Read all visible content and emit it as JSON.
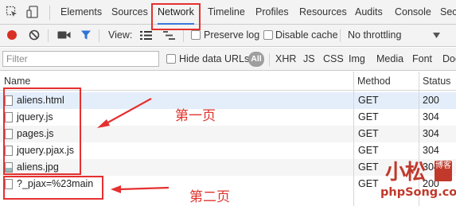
{
  "tabs": {
    "items": [
      "Elements",
      "Sources",
      "Network",
      "Timeline",
      "Profiles",
      "Resources",
      "Audits",
      "Console",
      "Sec"
    ],
    "active": "Network"
  },
  "toolbar": {
    "view_label": "View:",
    "preserve_log": "Preserve log",
    "disable_cache": "Disable cache",
    "throttling": "No throttling"
  },
  "filter": {
    "placeholder": "Filter",
    "hide_data_urls": "Hide data URLs",
    "all": "All",
    "types": [
      "XHR",
      "JS",
      "CSS",
      "Img",
      "Media",
      "Font",
      "Doc"
    ]
  },
  "table": {
    "headers": {
      "name": "Name",
      "method": "Method",
      "status": "Status"
    },
    "rows": [
      {
        "name": "aliens.html",
        "method": "GET",
        "status": "200"
      },
      {
        "name": "jquery.js",
        "method": "GET",
        "status": "304"
      },
      {
        "name": "pages.js",
        "method": "GET",
        "status": "304"
      },
      {
        "name": "jquery.pjax.js",
        "method": "GET",
        "status": "304"
      },
      {
        "name": "aliens.jpg",
        "method": "GET",
        "status": "304"
      },
      {
        "name": "?_pjax=%23main",
        "method": "GET",
        "status": "200"
      }
    ]
  },
  "annotations": {
    "page1": "第一页",
    "page2": "第二页"
  },
  "watermark": {
    "chars": "小松",
    "seal": "博客",
    "site": "phpSong.com"
  },
  "colors": {
    "accent": "#3879d9",
    "record": "#d93025",
    "annotation": "#e53030",
    "selected_row": "#e4eefb"
  }
}
